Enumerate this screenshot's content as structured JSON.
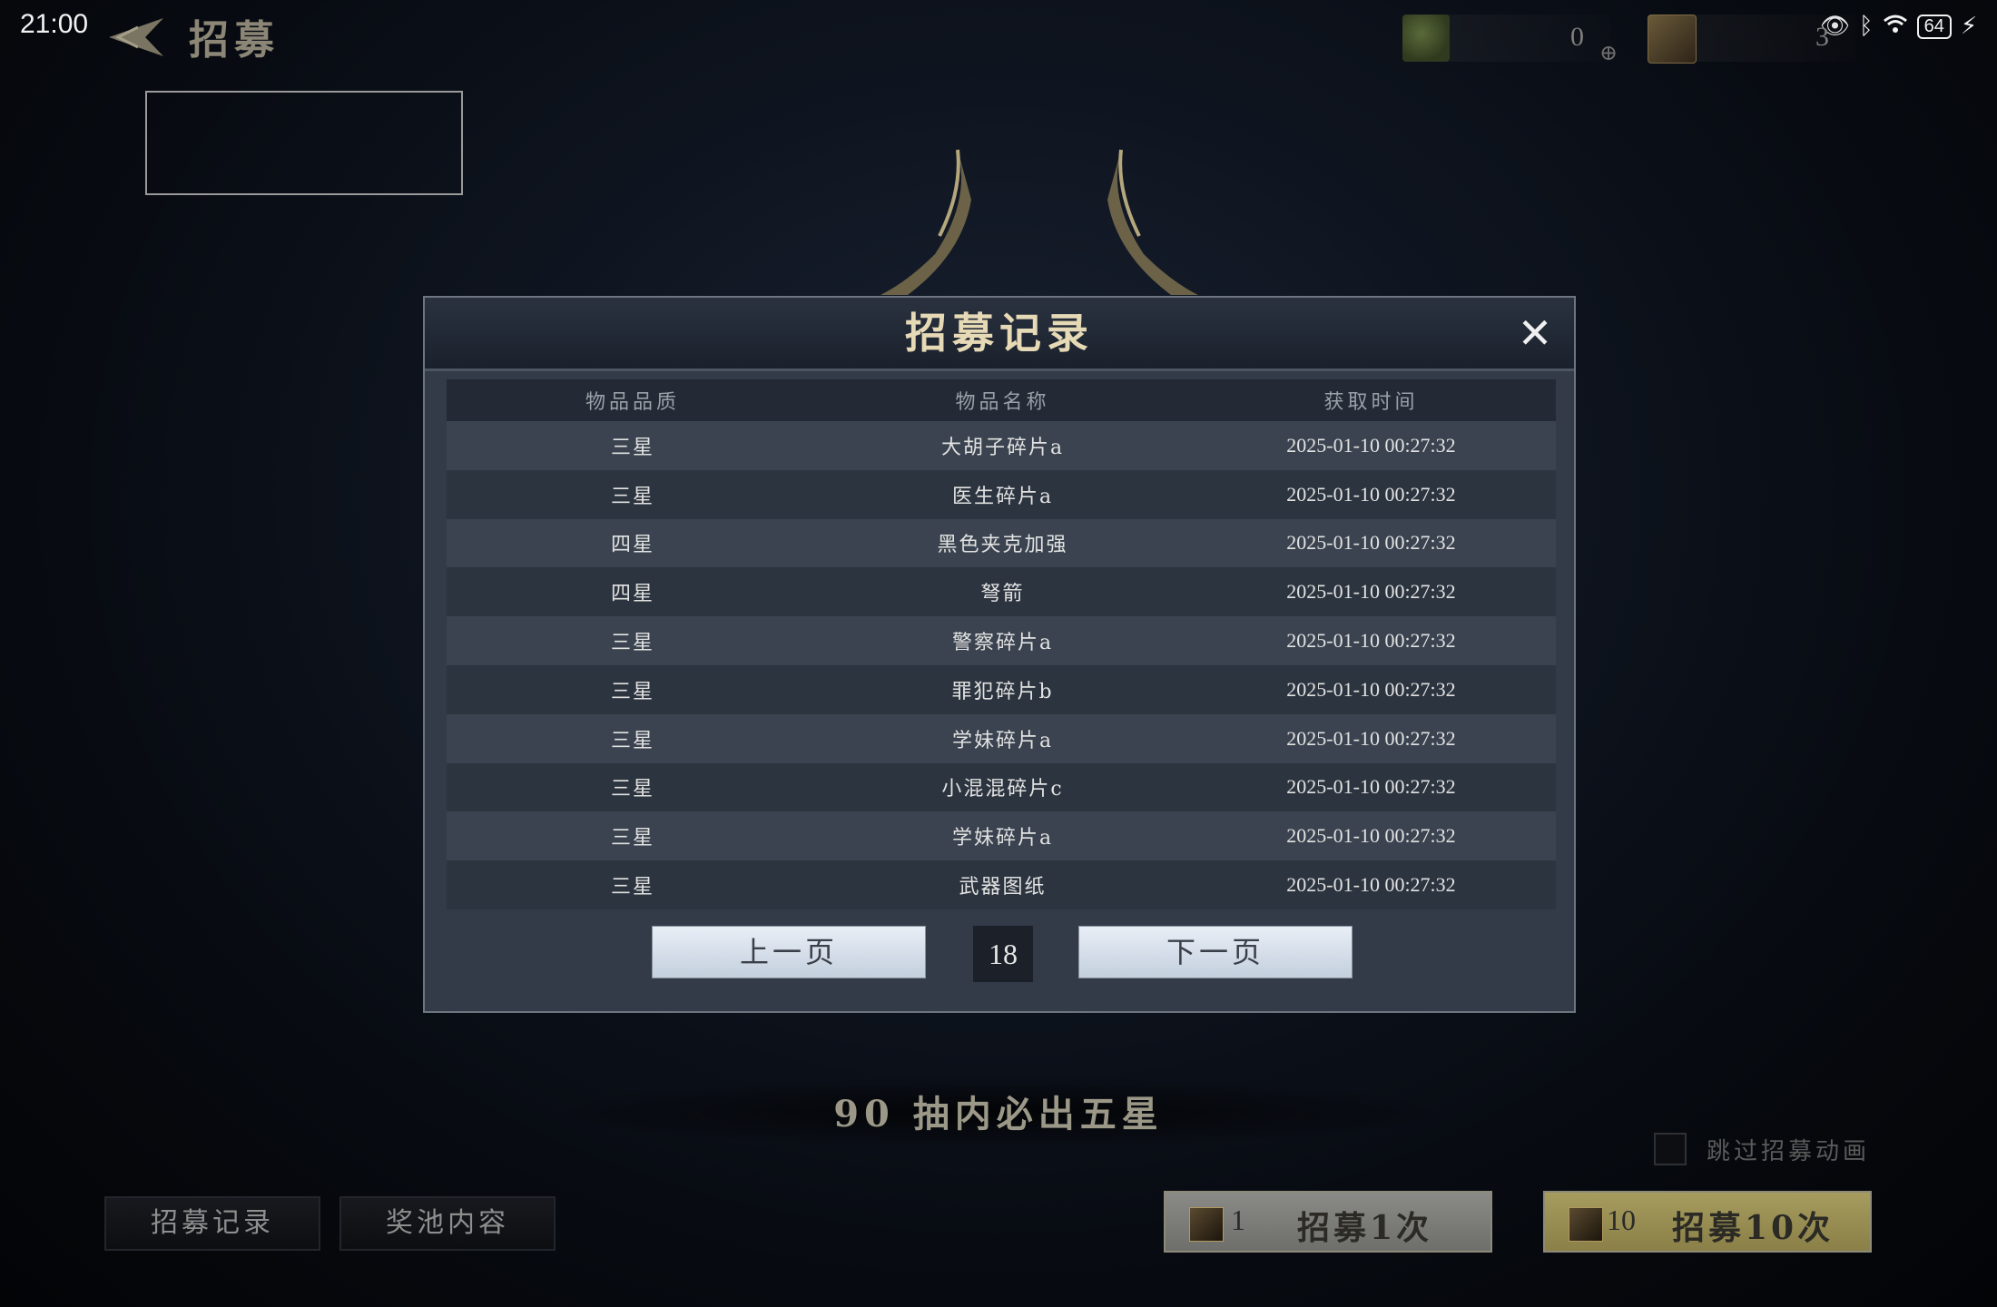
{
  "status_bar": {
    "time": "21:00",
    "battery": "64"
  },
  "header": {
    "title": "招募"
  },
  "currency": [
    {
      "icon": "gem-pouch-icon",
      "value": "0"
    },
    {
      "icon": "quill-ticket-icon",
      "value": "3"
    }
  ],
  "modal": {
    "title": "招募记录",
    "columns": [
      "物品品质",
      "物品名称",
      "获取时间"
    ],
    "rows": [
      {
        "quality": "三星",
        "name": "大胡子碎片a",
        "time": "2025-01-10 00:27:32"
      },
      {
        "quality": "三星",
        "name": "医生碎片a",
        "time": "2025-01-10 00:27:32"
      },
      {
        "quality": "四星",
        "name": "黑色夹克加强",
        "time": "2025-01-10 00:27:32"
      },
      {
        "quality": "四星",
        "name": "弩箭",
        "time": "2025-01-10 00:27:32"
      },
      {
        "quality": "三星",
        "name": "警察碎片a",
        "time": "2025-01-10 00:27:32"
      },
      {
        "quality": "三星",
        "name": "罪犯碎片b",
        "time": "2025-01-10 00:27:32"
      },
      {
        "quality": "三星",
        "name": "学妹碎片a",
        "time": "2025-01-10 00:27:32"
      },
      {
        "quality": "三星",
        "name": "小混混碎片c",
        "time": "2025-01-10 00:27:32"
      },
      {
        "quality": "三星",
        "name": "学妹碎片a",
        "time": "2025-01-10 00:27:32"
      },
      {
        "quality": "三星",
        "name": "武器图纸",
        "time": "2025-01-10 00:27:32"
      }
    ],
    "prev_label": "上一页",
    "page": "18",
    "next_label": "下一页"
  },
  "pity_text": "90 抽内必出五星",
  "skip_label": "跳过招募动画",
  "tabs": {
    "records": "招募记录",
    "pool": "奖池内容"
  },
  "draw": [
    {
      "cost": "1",
      "label": "招募1次"
    },
    {
      "cost": "10",
      "label": "招募10次"
    }
  ]
}
